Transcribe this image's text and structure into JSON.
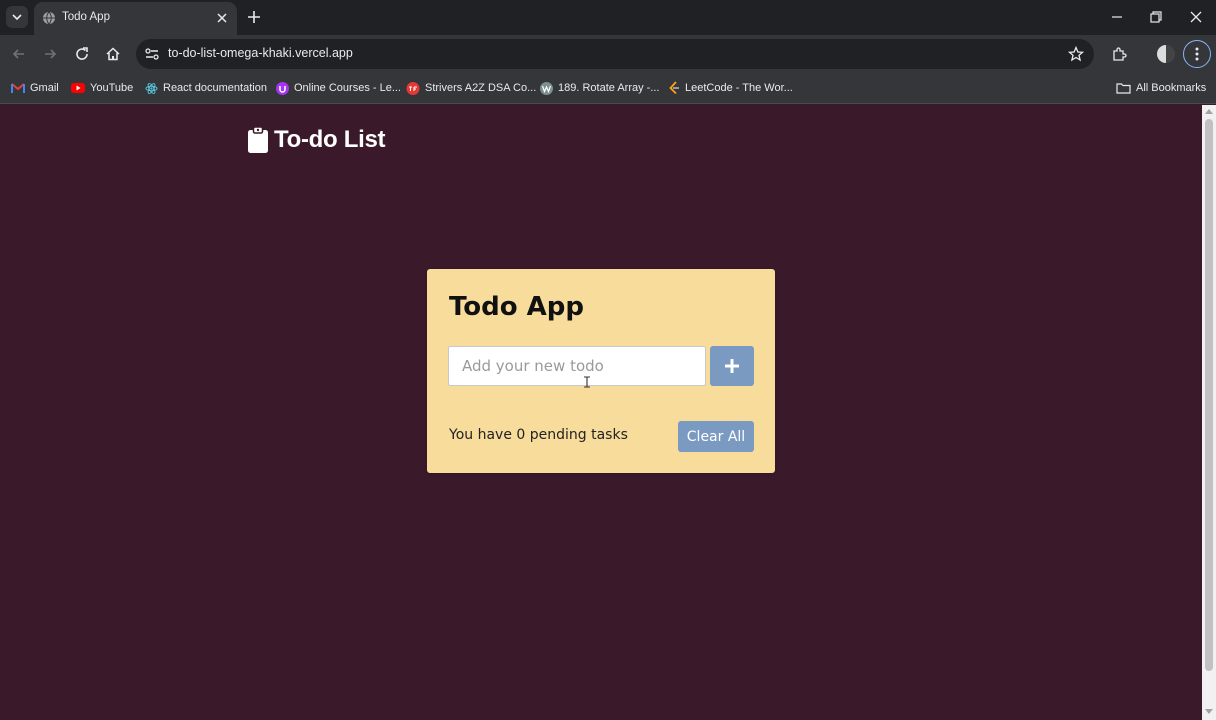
{
  "browser": {
    "tab": {
      "title": "Todo App"
    },
    "omnibox": {
      "url": "to-do-list-omega-khaki.vercel.app"
    },
    "bookmarks": [
      {
        "label": "Gmail",
        "icon": "gmail-icon",
        "color": "#ea4335"
      },
      {
        "label": "YouTube",
        "icon": "youtube-icon",
        "color": "#ff0000"
      },
      {
        "label": "React documentation",
        "icon": "react-icon",
        "color": "#58c4dc"
      },
      {
        "label": "Online Courses - Le...",
        "icon": "udemy-icon",
        "color": "#a435f0"
      },
      {
        "label": "Strivers A2Z DSA Co...",
        "icon": "tuf-icon",
        "color": "#e53935"
      },
      {
        "label": "189. Rotate Array -...",
        "icon": "w-icon",
        "color": "#8aa0a0"
      },
      {
        "label": "LeetCode - The Wor...",
        "icon": "leetcode-icon",
        "color": "#ffa116"
      }
    ],
    "all_bookmarks_label": "All Bookmarks"
  },
  "page": {
    "brand": "To-do List",
    "card": {
      "title": "Todo App",
      "input_placeholder": "Add your new todo",
      "add_button_label": "+",
      "pending_text": "You have 0 pending tasks",
      "clear_button_label": "Clear All"
    }
  },
  "colors": {
    "page_bg": "#3a1a2a",
    "card_bg": "#f8dc9c",
    "button_bg": "#7a9ac2"
  }
}
